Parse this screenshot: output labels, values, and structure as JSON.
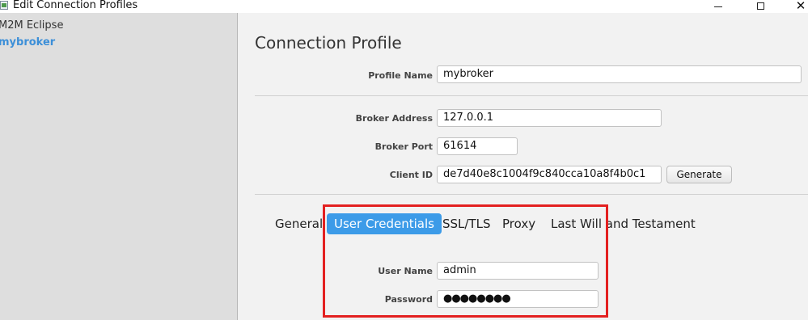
{
  "window": {
    "title": "Edit Connection Profiles",
    "icon": "app-icon",
    "controls": {
      "minimize": "minimize-icon",
      "maximize": "maximize-icon",
      "close_label": "✕"
    }
  },
  "sidebar": {
    "items": [
      {
        "label": "M2M Eclipse",
        "selected": false
      },
      {
        "label": "mybroker",
        "selected": true
      }
    ],
    "selected_color": "#3c8fd8"
  },
  "main": {
    "heading": "Connection Profile",
    "profile_name": {
      "label": "Profile Name",
      "value": "mybroker"
    },
    "broker_address": {
      "label": "Broker Address",
      "value": "127.0.0.1"
    },
    "broker_port": {
      "label": "Broker Port",
      "value": "61614"
    },
    "client_id": {
      "label": "Client ID",
      "value": "de7d40e8c1004f9c840cca10a8f4b0c1"
    },
    "generate_label": "Generate",
    "tabs": [
      {
        "label": "General",
        "active": false
      },
      {
        "label": "User Credentials",
        "active": true
      },
      {
        "label": "SSL/TLS",
        "active": false
      },
      {
        "label": "Proxy",
        "active": false
      },
      {
        "label": "Last Will and Testament",
        "active": false
      }
    ],
    "credentials": {
      "user_name": {
        "label": "User Name",
        "value": "admin"
      },
      "password": {
        "label": "Password",
        "value": "●●●●●●●●"
      }
    },
    "accent_color": "#3c9be8",
    "highlight_color": "#e32020"
  }
}
